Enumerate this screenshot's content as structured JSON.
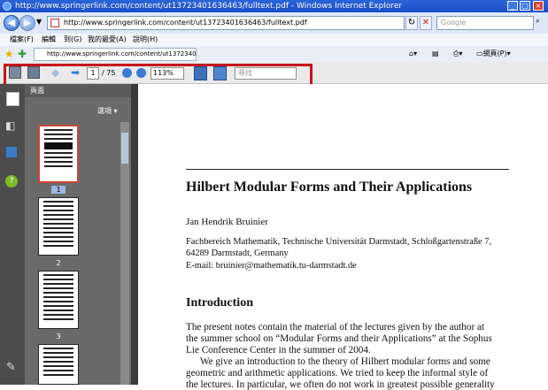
{
  "window": {
    "title": "http://www.springerlink.com/content/ut13723401636463/fulltext.pdf - Windows Internet Explorer"
  },
  "address": {
    "url": "http://www.springerlink.com/content/ut13723401636463/fulltext.pdf",
    "search_placeholder": "Google"
  },
  "menu": [
    "檔案(F)",
    "編輯",
    "到(G)",
    "我的最愛(A)",
    "說明(H)"
  ],
  "tab": {
    "title": "http://www.springerlink.com/content/ut13723401636463/fulltext.pdf",
    "page_menu": "網頁(P)"
  },
  "pdf_toolbar": {
    "page_current": "1",
    "page_total": "/ 75",
    "zoom": "113%",
    "find_placeholder": "尋找"
  },
  "sidebar": {
    "title": "頁面",
    "options": "選項",
    "thumbnails": [
      "1",
      "2",
      "3"
    ]
  },
  "paper": {
    "title": "Hilbert Modular Forms and Their Applications",
    "author": "Jan Hendrik Bruinier",
    "affiliation_1": "Fachbereich Mathematik, Technische Universität Darmstadt, Schloßgartenstraße 7,",
    "affiliation_2": "64289 Darmstadt, Germany",
    "email": "E-mail: bruinier@mathematik.tu-darmstadt.de",
    "section": "Introduction",
    "para1_l1": "The present notes contain the material of the lectures given by the author at",
    "para1_l2": "the summer school on “Modular Forms and their Applications” at the Sophus",
    "para1_l3": "Lie Conference Center in the summer of 2004.",
    "para2_l1": "We give an introduction to the theory of Hilbert modular forms and some",
    "para2_l2": "geometric and arithmetic applications. We tried to keep the informal style of",
    "para2_l3": "the lectures. In particular, we often do not work in greatest possible generality"
  },
  "colors": {
    "highlight_box": "#c4151c",
    "sidebar_bg": "#6a6a6a",
    "titlebar": "#1b4ec7"
  }
}
